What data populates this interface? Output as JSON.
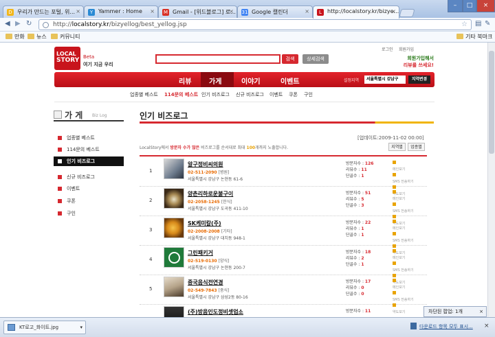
{
  "browser": {
    "tabs": [
      {
        "label": "우리가 만드는 포털, 위...",
        "icon_color": "#f2b61a",
        "icon": "daum-icon"
      },
      {
        "label": "Yammer : Home",
        "icon_color": "#2a8ad4",
        "icon": "yammer-icon"
      },
      {
        "label": "Gmail - [위드블로그] 로...",
        "icon_color": "#d93025",
        "icon": "gmail-icon"
      },
      {
        "label": "Google 캘린더",
        "icon_color": "#4285f4",
        "icon": "calendar-icon"
      },
      {
        "label": "http://localstory.kr/bizye...",
        "icon_color": "#c8141c",
        "icon": "localstory-icon"
      }
    ],
    "url_prefix": "http://",
    "url_host": "localstory.kr",
    "url_path": "/bizyellog/best_yellog.jsp",
    "bookmarks": [
      "만화",
      "뉴스",
      "커뮤니티"
    ],
    "other_bookmarks": "기타 북마크",
    "popup_blocked": "차단된 팝업: 1개",
    "download_file": "KT로고_화이트.jpg",
    "download_all": "다운로드 항목 모두 표시..."
  },
  "site": {
    "logo_line1": "LOCAL",
    "logo_line2": "STORY",
    "logo_beta": "Beta",
    "logo_tagline": "여기 지금 우리",
    "search_button": "검색",
    "detail_search_button": "상세검색",
    "login": "로그인",
    "join": "회원가입",
    "promo_line1": "회원가입해서",
    "promo_line2": "리뷰를 쓰세요!",
    "nav": [
      "리뷰",
      "가게",
      "이야기",
      "이벤트"
    ],
    "region_label": "설정지역",
    "region_value": "서울특별시 강남구",
    "region_button": "지역변경",
    "subnav": [
      "업종별 베스트",
      "114문의 베스트",
      "인기 비즈로그",
      "신규 비즈로그",
      "이벤트",
      "쿠폰",
      "구인"
    ]
  },
  "sidebar": {
    "title": "가 게",
    "subtitle": "Biz Log",
    "items": [
      "업종별 베스트",
      "114문의 베스트",
      "인기 비즈로그",
      "신규 비즈로그",
      "이벤트",
      "쿠폰",
      "구인"
    ]
  },
  "main": {
    "title": "인기 비즈로그",
    "updated": "[업데이트:2009-11-02 00:00]",
    "intro_pre": "LocalStory에서 ",
    "intro_red": "방문자 수가 많은",
    "intro_mid": " 비즈로그를 순서대로 최대 ",
    "intro_num": "100",
    "intro_post": "개까지 노출합니다.",
    "btn_region": "지역별",
    "btn_biz": "업종별",
    "labels": {
      "visits": "방문자수 : ",
      "reviews": "리뷰수 : ",
      "regulars": "단골수 : "
    },
    "actions": [
      "메인보기",
      "SMS 전송하기",
      "약도보기"
    ],
    "rows": [
      {
        "rank": "1",
        "name": "알구정비씨의원",
        "phone": "02-511-2090",
        "cat": "[병원]",
        "addr": "서울특별시 강남구 논현동 61-6",
        "visits": "126",
        "reviews": "11",
        "regulars": "1"
      },
      {
        "rank": "2",
        "name": "양촌리하로운불구이",
        "phone": "02-2058-1245",
        "cat": "[한식]",
        "addr": "서울특별시 강남구 도곡동 411-10",
        "visits": "51",
        "reviews": "5",
        "regulars": "3"
      },
      {
        "rank": "3",
        "name": "SK케미칼(주)",
        "phone": "02-2008-2008",
        "cat": "[기타]",
        "addr": "서울특별시 강남구 대치동 948-1",
        "visits": "22",
        "reviews": "1",
        "regulars": "1"
      },
      {
        "rank": "4",
        "name": "그린패키거",
        "phone": "02-519-0130",
        "cat": "[양식]",
        "addr": "서울특별시 강남구 논현동 200-7",
        "visits": "18",
        "reviews": "2",
        "regulars": "1"
      },
      {
        "rank": "5",
        "name": "중국음식전연경",
        "phone": "02-549-7843",
        "cat": "[중식]",
        "addr": "서울특별시 강남구 삼성2동 80-16",
        "visits": "17",
        "reviews": "0",
        "regulars": "0"
      },
      {
        "rank": "6",
        "name": "(주)방음인도정비셋업소",
        "phone": "",
        "cat": "",
        "addr": "",
        "visits": "11",
        "reviews": "",
        "regulars": ""
      }
    ]
  }
}
